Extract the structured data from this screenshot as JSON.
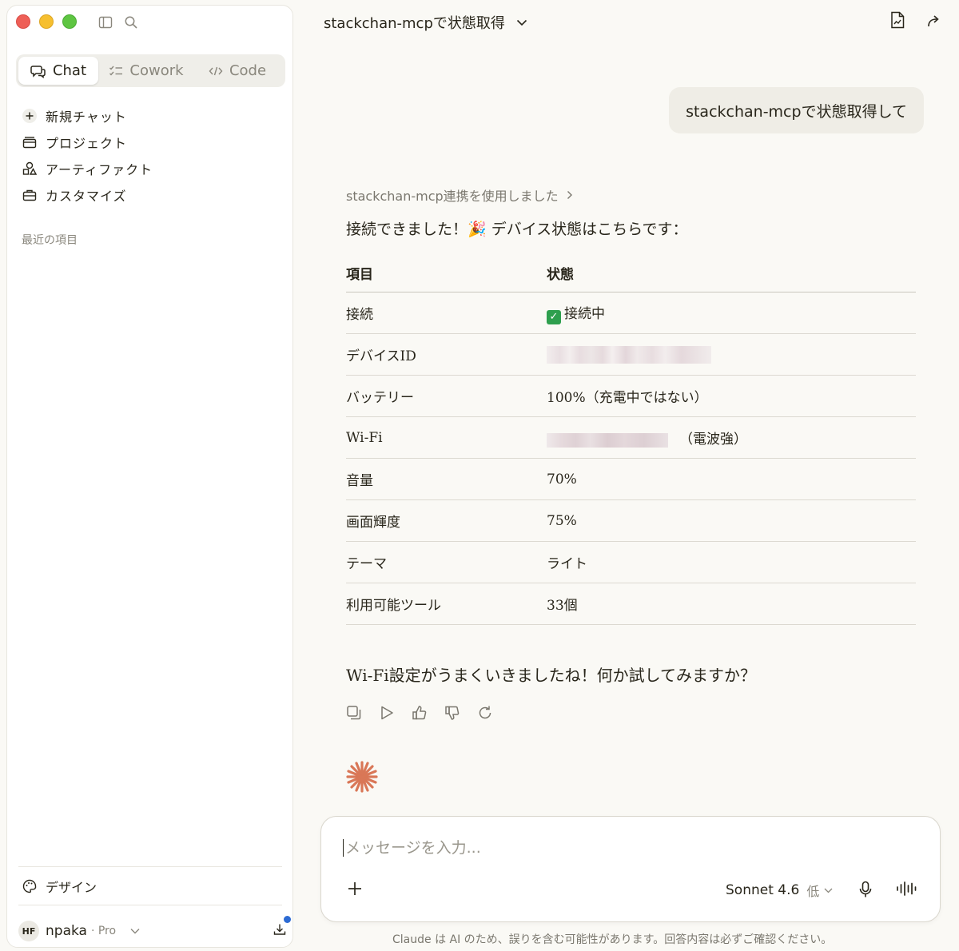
{
  "sidebar": {
    "modes": [
      {
        "label": "Chat",
        "icon": "chat-bubbles-icon"
      },
      {
        "label": "Cowork",
        "icon": "checklist-icon"
      },
      {
        "label": "Code",
        "icon": "code-brackets-icon"
      }
    ],
    "nav": [
      {
        "label": "新規チャット",
        "icon": "plus-icon"
      },
      {
        "label": "プロジェクト",
        "icon": "folder-icon"
      },
      {
        "label": "アーティファクト",
        "icon": "shapes-icon"
      },
      {
        "label": "カスタマイズ",
        "icon": "briefcase-icon"
      }
    ],
    "recents_label": "最近の項目",
    "design_label": "デザイン",
    "user": {
      "initials": "HF",
      "name": "npaka",
      "plan": "· Pro"
    }
  },
  "header": {
    "title": "stackchan-mcpで状態取得"
  },
  "conversation": {
    "user_message": "stackchan-mcpで状態取得して",
    "tool_used": "stackchan-mcp連携を使用しました",
    "intro": "接続できました！🎉 デバイス状態はこちらです：",
    "table": {
      "headers": [
        "項目",
        "状態"
      ],
      "rows": [
        {
          "item": "接続",
          "value": "接続中"
        },
        {
          "item": "デバイスID",
          "value": ""
        },
        {
          "item": "バッテリー",
          "value": "100%（充電中ではない）"
        },
        {
          "item": "Wi-Fi",
          "value": "（電波強）"
        },
        {
          "item": "音量",
          "value": "70%"
        },
        {
          "item": "画面輝度",
          "value": "75%"
        },
        {
          "item": "テーマ",
          "value": "ライト"
        },
        {
          "item": "利用可能ツール",
          "value": "33個"
        }
      ]
    },
    "closing": "Wi-Fi設定がうまくいきましたね！何か試してみますか？"
  },
  "composer": {
    "placeholder": "メッセージを入力...",
    "model": "Sonnet 4.6",
    "effort": "低"
  },
  "disclaimer": "Claude は AI のため、誤りを含む可能性があります。回答内容は必ずご確認ください。",
  "colors": {
    "accent": "#d97757",
    "background": "#faf9f5",
    "notification": "#2d6bd3"
  }
}
